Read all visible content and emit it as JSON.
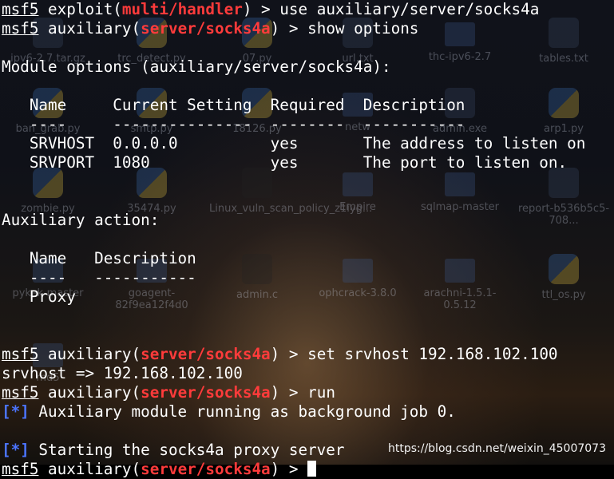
{
  "terminal": {
    "prompt": "msf5",
    "lines": [
      {
        "type": "prompt",
        "module_prefix": "exploit(",
        "module": "multi/handler",
        "module_suffix": ")",
        "cmd": " > use auxiliary/server/socks4a"
      },
      {
        "type": "prompt",
        "module_prefix": "auxiliary(",
        "module": "server/socks4a",
        "module_suffix": ")",
        "cmd": " > show options"
      },
      {
        "type": "text",
        "text": ""
      },
      {
        "type": "text",
        "text": "Module options (auxiliary/server/socks4a):"
      },
      {
        "type": "text",
        "text": ""
      },
      {
        "type": "text",
        "text": "   Name     Current Setting  Required  Description"
      },
      {
        "type": "text",
        "text": "   ----     ---------------  --------  -----------"
      },
      {
        "type": "text",
        "text": "   SRVHOST  0.0.0.0          yes       The address to listen on"
      },
      {
        "type": "text",
        "text": "   SRVPORT  1080             yes       The port to listen on."
      },
      {
        "type": "text",
        "text": ""
      },
      {
        "type": "text",
        "text": ""
      },
      {
        "type": "text",
        "text": "Auxiliary action:"
      },
      {
        "type": "text",
        "text": ""
      },
      {
        "type": "text",
        "text": "   Name   Description"
      },
      {
        "type": "text",
        "text": "   ----   -----------"
      },
      {
        "type": "text",
        "text": "   Proxy"
      },
      {
        "type": "text",
        "text": ""
      },
      {
        "type": "text",
        "text": ""
      },
      {
        "type": "prompt",
        "module_prefix": "auxiliary(",
        "module": "server/socks4a",
        "module_suffix": ")",
        "cmd": " > set srvhost 192.168.102.100"
      },
      {
        "type": "text",
        "text": "srvhost => 192.168.102.100"
      },
      {
        "type": "prompt",
        "module_prefix": "auxiliary(",
        "module": "server/socks4a",
        "module_suffix": ")",
        "cmd": " > run"
      },
      {
        "type": "status",
        "marker": "[*]",
        "text": " Auxiliary module running as background job 0."
      },
      {
        "type": "text",
        "text": ""
      },
      {
        "type": "status",
        "marker": "[*]",
        "text": " Starting the socks4a proxy server"
      },
      {
        "type": "prompt_partial",
        "module_prefix": "auxiliary(",
        "module": "server/socks4a",
        "module_suffix": ")",
        "cmd": " > ",
        "cursor": true
      }
    ]
  },
  "desktop_icons": [
    {
      "label": "ipv6-2.7.tar.gz",
      "icon": "archive-icon"
    },
    {
      "label": "trc_detect.py",
      "icon": "python-file-icon"
    },
    {
      "label": "07.py",
      "icon": "python-file-icon"
    },
    {
      "label": "url.txt",
      "icon": "text-file-icon"
    },
    {
      "label": "thc-ipv6-2.7",
      "icon": "folder-icon"
    },
    {
      "label": "tables.txt",
      "icon": "text-file-icon"
    },
    {
      "label": "ban_grab.py",
      "icon": "python-file-icon"
    },
    {
      "label": "smtp.py",
      "icon": "python-file-icon"
    },
    {
      "label": "18126.py",
      "icon": "python-file-icon"
    },
    {
      "label": "netw",
      "icon": "folder-icon"
    },
    {
      "label": "admin.exe",
      "icon": "exe-icon"
    },
    {
      "label": "arp1.py",
      "icon": "python-file-icon"
    },
    {
      "label": "zombie.py",
      "icon": "python-file-icon"
    },
    {
      "label": "35474.py",
      "icon": "python-file-icon"
    },
    {
      "label": "Linux_vuln_scan_policy_z1iyg...",
      "icon": "code-file-icon"
    },
    {
      "label": "Empire",
      "icon": "folder-icon"
    },
    {
      "label": "sqlmap-master",
      "icon": "folder-icon"
    },
    {
      "label": "report-b536b5c5-708...",
      "icon": "text-file-icon"
    },
    {
      "label": "pykek-master",
      "icon": "folder-icon"
    },
    {
      "label": "goagent-82f9ea12f4d0",
      "icon": "folder-icon"
    },
    {
      "label": "admin.c",
      "icon": "c-file-icon"
    },
    {
      "label": "ophcrack-3.8.0",
      "icon": "folder-icon"
    },
    {
      "label": "arachni-1.5.1-0.5.12",
      "icon": "folder-icon"
    },
    {
      "label": "ttl_os.py",
      "icon": "python-file-icon"
    },
    {
      "label": "md5",
      "icon": "folder-icon"
    }
  ],
  "watermark": "https://blog.csdn.net/weixin_45007073",
  "colors": {
    "module": "#ff3b3b",
    "status": "#4b74ff",
    "text": "#ffffff",
    "background": "#000000"
  }
}
